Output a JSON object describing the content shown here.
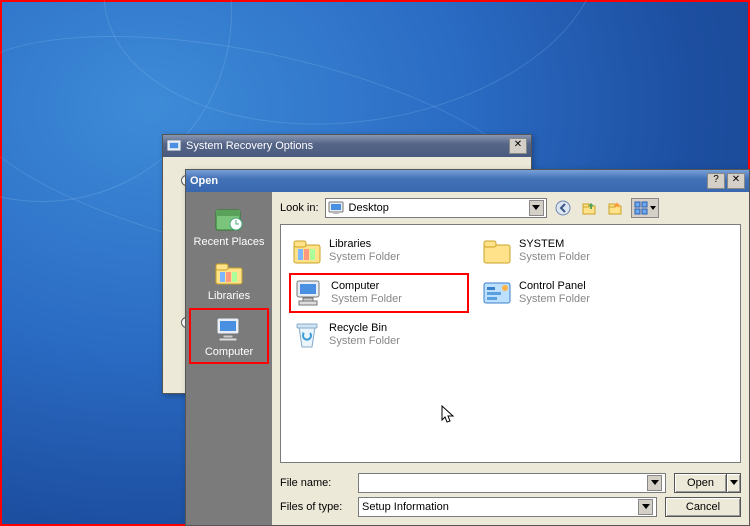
{
  "recovery_window": {
    "title": "System Recovery Options"
  },
  "open_dialog": {
    "title": "Open",
    "look_in_label": "Look in:",
    "look_in_value": "Desktop",
    "sidebar": [
      {
        "label": "Recent Places",
        "icon": "recent"
      },
      {
        "label": "Libraries",
        "icon": "libraries"
      },
      {
        "label": "Computer",
        "icon": "computer",
        "highlight": true
      }
    ],
    "items": [
      {
        "name": "Libraries",
        "sub": "System Folder",
        "icon": "libraries-big"
      },
      {
        "name": "SYSTEM",
        "sub": "System Folder",
        "icon": "folder"
      },
      {
        "name": "Computer",
        "sub": "System Folder",
        "icon": "computer-big",
        "highlight": true
      },
      {
        "name": "Control Panel",
        "sub": "System Folder",
        "icon": "control"
      },
      {
        "name": "Recycle Bin",
        "sub": "System Folder",
        "icon": "recycle"
      }
    ],
    "file_name_label": "File name:",
    "file_name_value": "",
    "file_type_label": "Files of type:",
    "file_type_value": "Setup Information",
    "open_button": "Open",
    "cancel_button": "Cancel"
  }
}
